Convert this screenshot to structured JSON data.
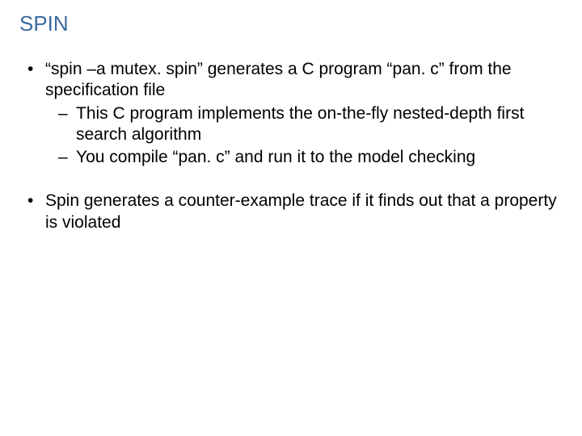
{
  "title": "SPIN",
  "bullets": [
    {
      "text": "“spin –a mutex. spin” generates a C program “pan. c” from the specification file",
      "sub": [
        "This C program implements the on-the-fly nested-depth first search algorithm",
        "You compile “pan. c” and run it to the model checking"
      ]
    },
    {
      "text": "Spin generates a counter-example trace if it finds out that a property is violated",
      "sub": []
    }
  ]
}
